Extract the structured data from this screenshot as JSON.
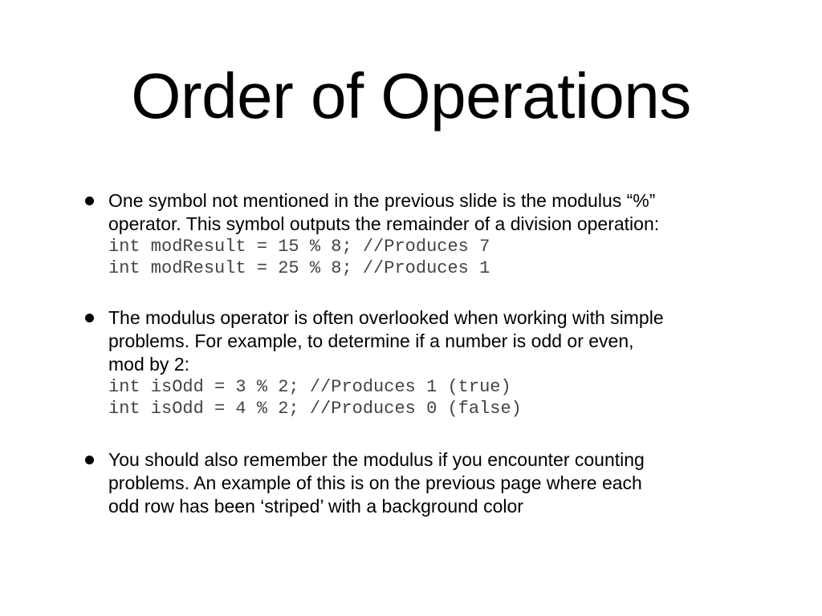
{
  "slide": {
    "title": "Order of Operations",
    "bullets": [
      {
        "lines": [
          "One symbol not mentioned in the previous slide is the modulus “%”",
          "operator. This symbol outputs the remainder of a division operation:"
        ],
        "code": [
          "int modResult = 15 % 8; //Produces 7",
          "int modResult = 25 % 8; //Produces 1"
        ]
      },
      {
        "lines": [
          "The modulus operator is often overlooked when working with simple",
          "problems. For example, to determine if a number is odd or even,",
          "mod by 2:"
        ],
        "code": [
          "int isOdd = 3 % 2; //Produces 1 (true)",
          "int isOdd = 4 % 2; //Produces 0 (false)"
        ]
      },
      {
        "lines": [
          "You should also remember the modulus if you encounter counting",
          "problems. An example of this is on the previous page where each",
          "odd row has been ‘striped’ with a background color"
        ],
        "code": []
      }
    ]
  }
}
